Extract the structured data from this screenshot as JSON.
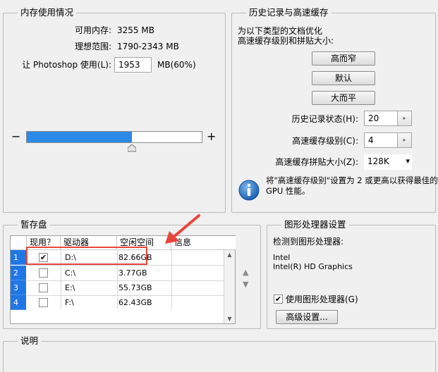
{
  "memory": {
    "legend": "内存使用情况",
    "available_label": "可用内存:",
    "available_value": "3255 MB",
    "ideal_label": "理想范围:",
    "ideal_value": "1790-2343 MB",
    "let_label": "让 Photoshop 使用(L):",
    "let_value": "1953",
    "let_unit": "MB(60%)",
    "minus": "−",
    "plus": "+",
    "slider_fraction": 0.6
  },
  "history": {
    "legend": "历史记录与高速缓存",
    "desc_line1": "为以下类型的文档优化",
    "desc_line2": "高速缓存级别和拼贴大小:",
    "btn_tall": "高而窄",
    "btn_default": "默认",
    "btn_wide": "大而平",
    "states_label": "历史记录状态(H):",
    "states_value": "20",
    "cache_level_label": "高速缓存级别(C):",
    "cache_level_value": "4",
    "tile_label": "高速缓存拼贴大小(Z):",
    "tile_value": "128K",
    "info_line1": "将\"高速缓存级别\"设置为 2 或更高以获得最佳的",
    "info_line2": "GPU 性能。",
    "spin_glyph": "▸",
    "dropdown_glyph": "▾"
  },
  "scratch": {
    "legend": "暂存盘",
    "headers": [
      "现用？",
      "驱动器",
      "空闲空间",
      "信息"
    ],
    "rows": [
      {
        "num": "1",
        "checked": true,
        "drive": "D:\\",
        "free": "82.66GB"
      },
      {
        "num": "2",
        "checked": false,
        "drive": "C:\\",
        "free": "3.77GB"
      },
      {
        "num": "3",
        "checked": false,
        "drive": "E:\\",
        "free": "55.73GB"
      },
      {
        "num": "4",
        "checked": false,
        "drive": "F:\\",
        "free": "62.43GB"
      }
    ],
    "check_glyph": "✔",
    "up_glyph": "▲",
    "down_glyph": "▼",
    "scroll_up": "▲",
    "scroll_down": "▼"
  },
  "gpu": {
    "legend": "图形处理器设置",
    "detected_label": "检测到图形处理器:",
    "vendor": "Intel",
    "model": "Intel(R) HD Graphics",
    "use_gpu_label": "使用图形处理器(G)",
    "use_gpu_checked": true,
    "advanced_button": "高级设置..."
  },
  "description": {
    "legend": "说明"
  },
  "colors": {
    "accent": "#1f77e5",
    "annotation": "#e8463a"
  }
}
